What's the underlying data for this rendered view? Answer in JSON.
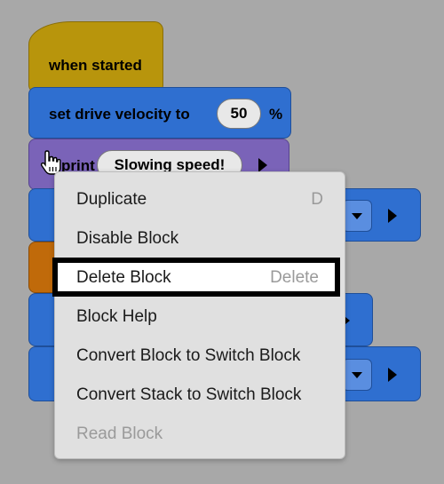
{
  "blocks": {
    "when_started": "when started",
    "set_velocity": "set drive velocity to",
    "velocity_value": "50",
    "velocity_unit": "%",
    "print_prefix": "print",
    "print_value": "Slowing speed!"
  },
  "context_menu": {
    "items": [
      {
        "label": "Duplicate",
        "shortcut": "D"
      },
      {
        "label": "Disable Block",
        "shortcut": ""
      },
      {
        "label": "Delete Block",
        "shortcut": "Delete"
      },
      {
        "label": "Block Help",
        "shortcut": ""
      },
      {
        "label": "Convert Block to Switch Block",
        "shortcut": ""
      },
      {
        "label": "Convert Stack to Switch Block",
        "shortcut": ""
      },
      {
        "label": "Read Block",
        "shortcut": ""
      }
    ]
  },
  "colors": {
    "events": "#b8950c",
    "motion": "#2f6fd0",
    "looks": "#7a63b8",
    "control": "#c06a0a",
    "workspace": "#a8a8a8"
  },
  "icons": [
    "hand-cursor-icon",
    "dropdown-arrow-icon",
    "play-arrow-icon"
  ]
}
